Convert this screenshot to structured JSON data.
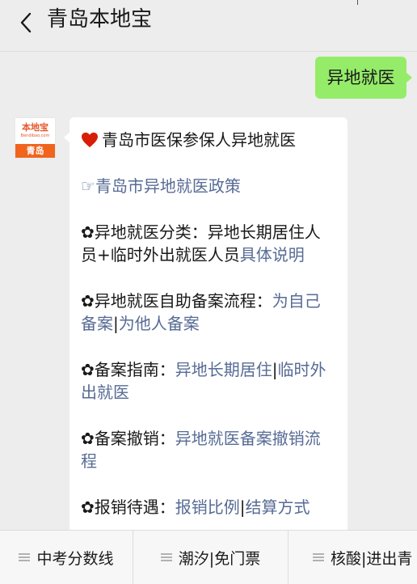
{
  "header": {
    "title": "青岛本地宝",
    "back_icon": "chevron-left-icon"
  },
  "user_message": {
    "text": "异地就医"
  },
  "bot": {
    "avatar": {
      "brand": "本地宝",
      "url": "Bendibao.com",
      "city": "青岛"
    },
    "message": {
      "title_icon": "heart-icon",
      "title": "青岛市医保参保人异地就医",
      "policy_icon": "pointing-hand-icon",
      "policy_link": "青岛市异地就医政策",
      "bullet_icon": "flower-bullet-icon",
      "bullet": "✿",
      "category": {
        "label": "异地就医分类：异地长期居住人员+临时外出就医人员",
        "label_line1": "异地就医分类：异地长期居住人",
        "label_line2": "员+临时外出就医人员",
        "link": "具体说明"
      },
      "self_filing": {
        "label": "异地就医自助备案流程：",
        "link_self": "为自己备案",
        "link_self_line1": "为自己",
        "link_self_line2": "备案",
        "separator": "|",
        "link_others": "为他人备案"
      },
      "guide": {
        "label": "备案指南：",
        "link_long_term": "异地长期居住",
        "separator": "|",
        "link_temporary": "临时外出就医",
        "link_temporary_line1": "临时外",
        "link_temporary_line2": "出就医"
      },
      "cancel": {
        "label": "备案撤销：",
        "link": "异地就医备案撤销流程",
        "link_line1": "异地就医备案撤销流",
        "link_line2": "程"
      },
      "reimburse": {
        "label": "报销待遇：",
        "link_ratio": "报销比例",
        "separator": "|",
        "link_method": "结算方式"
      }
    }
  },
  "bottom_menu": {
    "items": [
      {
        "label": "中考分数线",
        "icon": "menu-icon"
      },
      {
        "label": "潮汐|免门票",
        "icon": "menu-icon"
      },
      {
        "label": "核酸|进出青",
        "icon": "menu-icon"
      }
    ]
  },
  "colors": {
    "background": "#ededed",
    "user_bubble": "#95ec69",
    "link": "#576b95",
    "avatar_orange": "#f0641e",
    "heart": "#d81e06"
  }
}
